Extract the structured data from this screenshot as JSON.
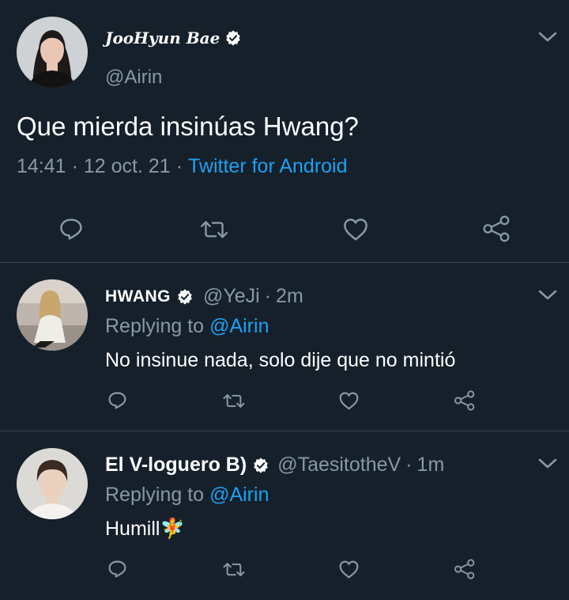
{
  "main_tweet": {
    "display_name": "JooHyun Bae",
    "handle": "@Airin",
    "text": "Que mierda insinúas Hwang?",
    "time": "14:41",
    "separator": "·",
    "date": "12 oct. 21",
    "source": "Twitter for Android"
  },
  "replies": [
    {
      "display_name": "HWANG",
      "handle": "@YeJi",
      "separator": "·",
      "age": "2m",
      "replying_prefix": "Replying to",
      "replying_to": "@Airin",
      "text": "No insinue nada, solo dije que no mintió"
    },
    {
      "display_name": "El V-loguero B)",
      "handle": "@TaesitotheV",
      "separator": "·",
      "age": "1m",
      "replying_prefix": "Replying to",
      "replying_to": "@Airin",
      "text": "Humill🧚"
    }
  ],
  "icons": [
    "chevron-down-icon",
    "verified-icon",
    "reply-icon",
    "retweet-icon",
    "like-icon",
    "share-icon"
  ],
  "colors": {
    "background": "#15202b",
    "text": "#ffffff",
    "muted": "#8899a6",
    "link": "#1da1f2",
    "divider": "#38444d"
  }
}
